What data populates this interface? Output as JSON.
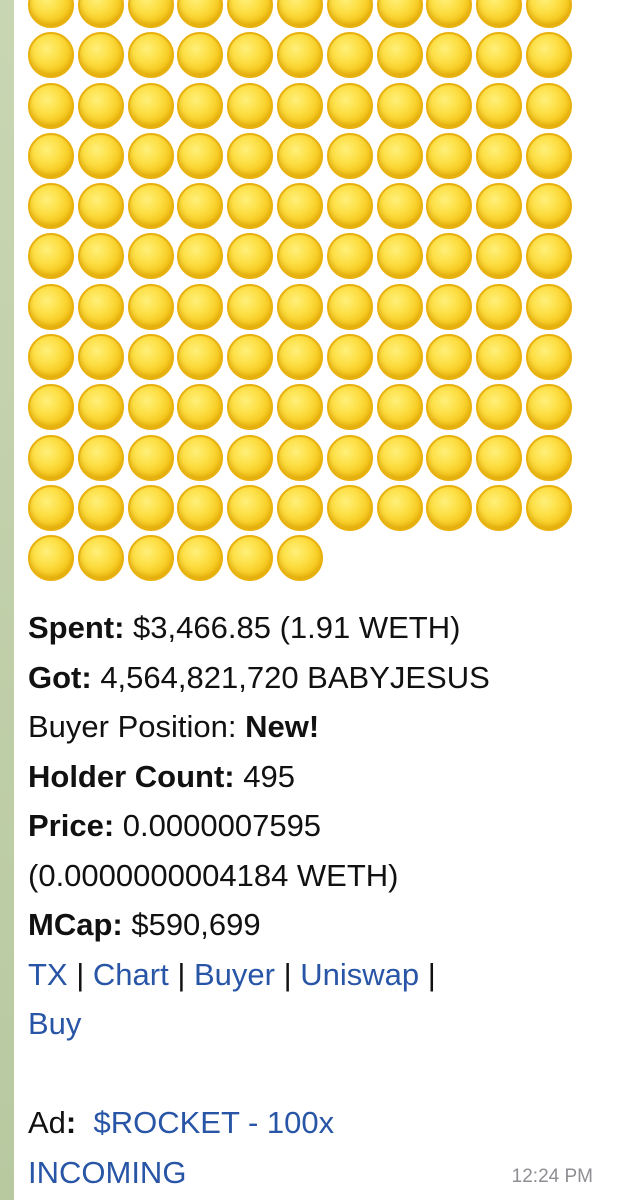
{
  "coin_grid": {
    "icon": "coin-emoji",
    "color": "#fde047",
    "rows": [
      11,
      11,
      11,
      11,
      11,
      11,
      11,
      11,
      11,
      11,
      11,
      6
    ]
  },
  "message": {
    "spent_label": "Spent:",
    "spent_value": " $3,466.85 (1.91 WETH)",
    "got_label": "Got:",
    "got_value": " 4,564,821,720 BABYJESUS",
    "buyer_position_label": "Buyer Position: ",
    "buyer_position_value": "New!",
    "holder_count_label": "Holder Count:",
    "holder_count_value": " 495",
    "price_label": "Price:",
    "price_value": " 0.0000007595",
    "price_weth": "(0.0000000004184 WETH)",
    "mcap_label": "MCap:",
    "mcap_value": " $590,699",
    "links": {
      "tx": "TX",
      "chart": "Chart",
      "buyer": "Buyer",
      "uniswap": "Uniswap",
      "buy": "Buy",
      "separator": " | "
    },
    "ad_label": "Ad",
    "ad_colon": ":",
    "ad_link_line1": "$ROCKET - 100x",
    "ad_link_line2": "INCOMING",
    "timestamp": "12:24 PM"
  },
  "colors": {
    "link": "#2855a6",
    "text": "#111111",
    "timestamp": "#8e8e93"
  }
}
